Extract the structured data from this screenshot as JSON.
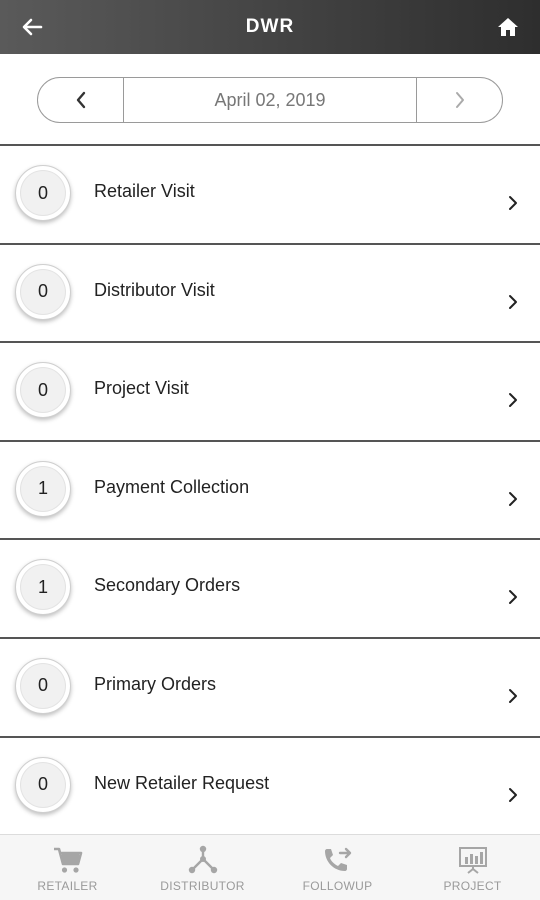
{
  "header": {
    "title": "DWR",
    "back_icon": "back-arrow-icon",
    "home_icon": "home-icon"
  },
  "date_nav": {
    "date": "April 02, 2019",
    "prev_icon": "chevron-left-icon",
    "next_icon": "chevron-right-icon"
  },
  "items": [
    {
      "count": "0",
      "label": "Retailer Visit"
    },
    {
      "count": "0",
      "label": "Distributor Visit"
    },
    {
      "count": "0",
      "label": "Project Visit"
    },
    {
      "count": "1",
      "label": "Payment Collection"
    },
    {
      "count": "1",
      "label": "Secondary Orders"
    },
    {
      "count": "0",
      "label": "Primary Orders"
    },
    {
      "count": "0",
      "label": "New Retailer Request"
    }
  ],
  "bottom_nav": [
    {
      "label": "RETAILER",
      "icon": "cart-icon"
    },
    {
      "label": "DISTRIBUTOR",
      "icon": "network-icon"
    },
    {
      "label": "FOLLOWUP",
      "icon": "phone-forward-icon"
    },
    {
      "label": "PROJECT",
      "icon": "presentation-chart-icon"
    }
  ]
}
